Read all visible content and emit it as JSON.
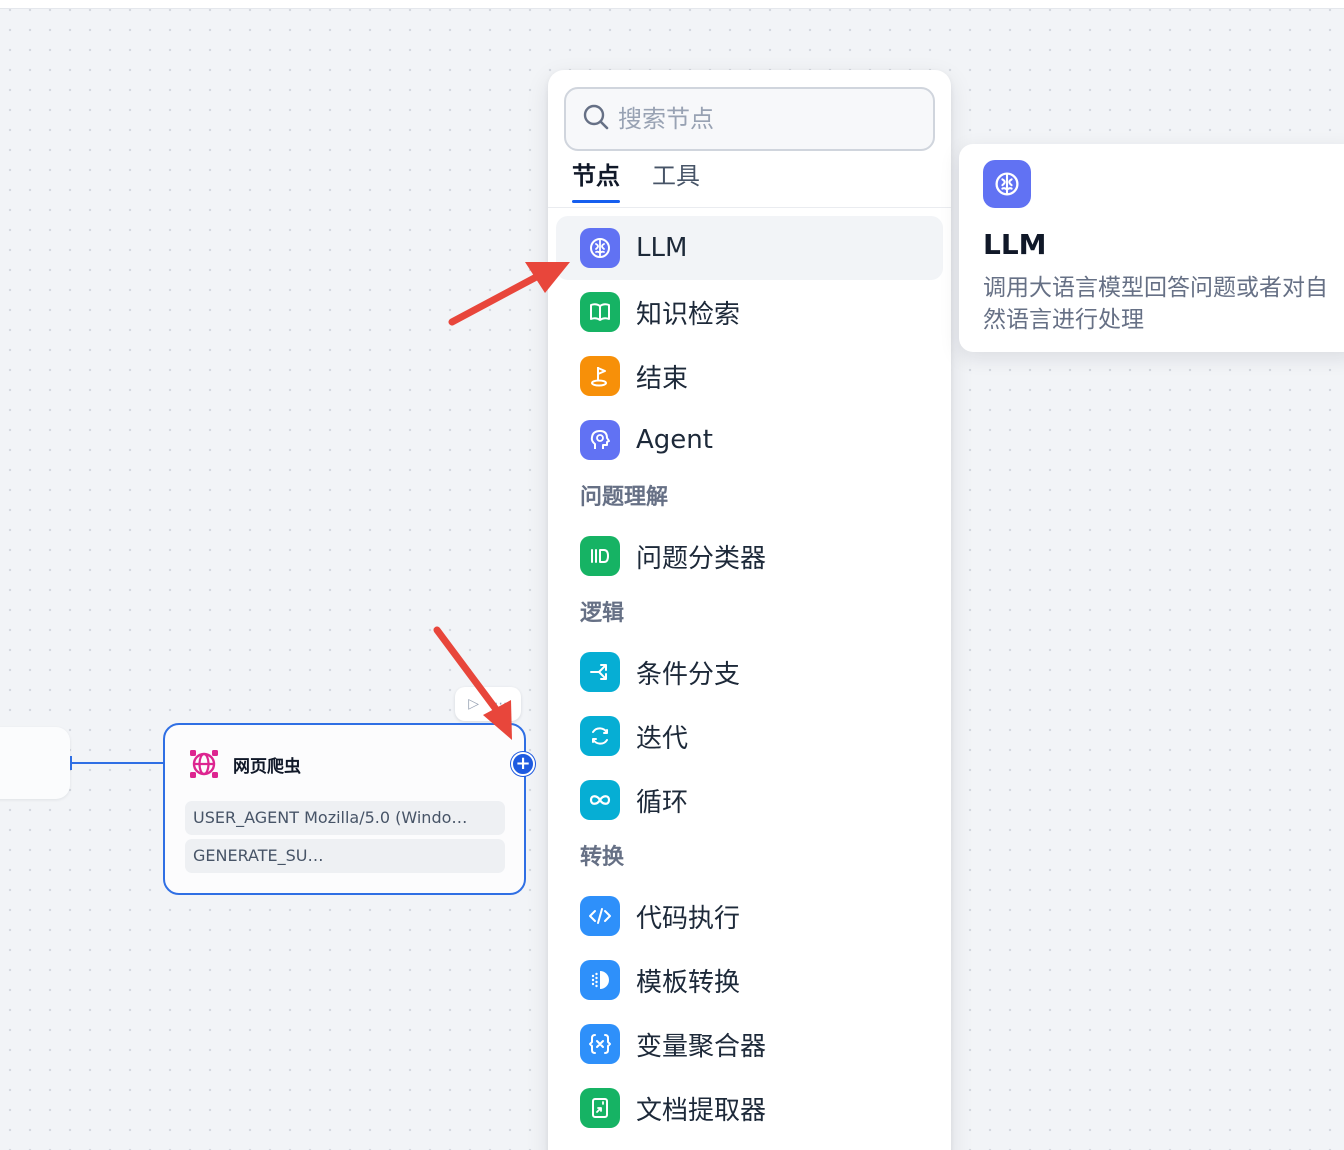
{
  "canvas": {
    "crawler_node": {
      "title": "网页爬虫",
      "variables": [
        "USER_AGENT Mozilla/5.0 (Windo…",
        "GENERATE_SU…"
      ],
      "icon": "globe-network-icon",
      "add_handle_label": "+"
    }
  },
  "panel": {
    "search": {
      "placeholder": "搜索节点",
      "value": ""
    },
    "tabs": [
      {
        "label": "节点",
        "active": true
      },
      {
        "label": "工具",
        "active": false
      }
    ],
    "items_top": [
      {
        "label": "LLM",
        "icon": "brain-icon",
        "color": "#6172f3"
      },
      {
        "label": "知识检索",
        "icon": "book-icon",
        "color": "#16b364"
      },
      {
        "label": "结束",
        "icon": "flag-icon",
        "color": "#f79009"
      },
      {
        "label": "Agent",
        "icon": "agent-head-icon",
        "color": "#6172f3"
      }
    ],
    "groups": [
      {
        "title": "问题理解",
        "items": [
          {
            "label": "问题分类器",
            "icon": "classifier-icon",
            "color": "#16b364"
          }
        ]
      },
      {
        "title": "逻辑",
        "items": [
          {
            "label": "条件分支",
            "icon": "branch-icon",
            "color": "#06aed4"
          },
          {
            "label": "迭代",
            "icon": "iteration-icon",
            "color": "#06aed4"
          },
          {
            "label": "循环",
            "icon": "infinity-icon",
            "color": "#06aed4"
          }
        ]
      },
      {
        "title": "转换",
        "items": [
          {
            "label": "代码执行",
            "icon": "code-icon",
            "color": "#2e90fa"
          },
          {
            "label": "模板转换",
            "icon": "template-icon",
            "color": "#2e90fa"
          },
          {
            "label": "变量聚合器",
            "icon": "variable-icon",
            "color": "#2e90fa"
          },
          {
            "label": "文档提取器",
            "icon": "document-icon",
            "color": "#16b364"
          }
        ]
      }
    ]
  },
  "tooltip": {
    "title": "LLM",
    "description": "调用大语言模型回答问题或者对自然语言进行处理",
    "icon": "brain-icon",
    "color": "#6172f3"
  },
  "colors": {
    "accent": "#155eef",
    "edge": "#2f6fe4",
    "arrow": "#e8463b"
  }
}
